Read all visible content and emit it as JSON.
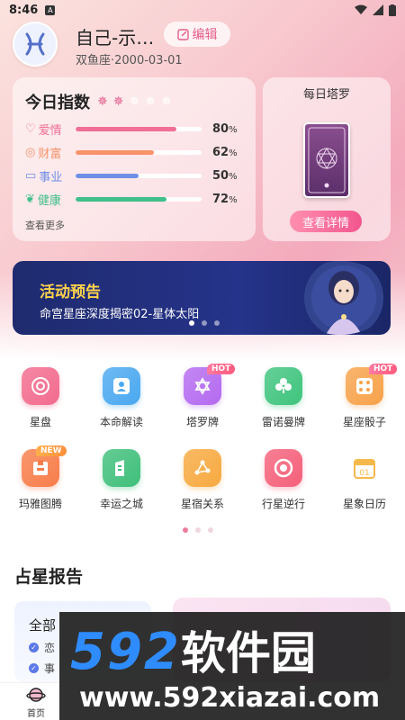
{
  "status": {
    "time": "8:46"
  },
  "profile": {
    "name": "自己-示…",
    "edit_label": "编辑",
    "subtitle": "双鱼座·2000-03-01"
  },
  "today_index": {
    "title": "今日指数",
    "stars_filled": 2,
    "stars_total": 5,
    "more_label": "查看更多",
    "items": [
      {
        "label": "爱情",
        "value": "80",
        "unit": "%",
        "percent": 80,
        "color": "#ef6f97",
        "icon": "heart-icon"
      },
      {
        "label": "财富",
        "value": "62",
        "unit": "%",
        "percent": 62,
        "color": "#f7926a",
        "icon": "coin-icon"
      },
      {
        "label": "事业",
        "value": "50",
        "unit": "%",
        "percent": 50,
        "color": "#6f8fe6",
        "icon": "briefcase-icon"
      },
      {
        "label": "健康",
        "value": "72",
        "unit": "%",
        "percent": 72,
        "color": "#3fbf8a",
        "icon": "leaf-icon"
      }
    ]
  },
  "daily_tarot": {
    "title": "每日塔罗",
    "button_label": "查看详情"
  },
  "banner": {
    "title": "活动预告",
    "subtitle": "命宫星座深度揭密02-星体太阳",
    "pages": 3,
    "active_page": 0
  },
  "features": [
    {
      "label": "星盘",
      "icon": "chart-wheel-icon",
      "color": "#f26b8e",
      "badge": ""
    },
    {
      "label": "本命解读",
      "icon": "person-card-icon",
      "color": "#4aa8f0",
      "badge": ""
    },
    {
      "label": "塔罗牌",
      "icon": "tarot-star-icon",
      "color": "#b46af0",
      "badge": "HOT"
    },
    {
      "label": "雷诺曼牌",
      "icon": "club-icon",
      "color": "#3fc47d",
      "badge": ""
    },
    {
      "label": "星座骰子",
      "icon": "dice-icon",
      "color": "#f7a24a",
      "badge": "HOT"
    },
    {
      "label": "玛雅图腾",
      "icon": "totem-icon",
      "color": "#f77d4a",
      "badge": "NEW"
    },
    {
      "label": "幸运之城",
      "icon": "building-icon",
      "color": "#3fbf7a",
      "badge": ""
    },
    {
      "label": "星宿关系",
      "icon": "constellation-icon",
      "color": "#f7a93f",
      "badge": ""
    },
    {
      "label": "行星逆行",
      "icon": "planet-ring-icon",
      "color": "#f4607a",
      "badge": ""
    },
    {
      "label": "星象日历",
      "icon": "calendar-icon",
      "color": "#f7b84a",
      "badge": "",
      "calendar_day": "01"
    }
  ],
  "features_pages": 3,
  "report": {
    "section_title": "占星报告",
    "card_title": "全部",
    "items": [
      "恋",
      "事"
    ]
  },
  "bottom_nav": {
    "home_label": "首页"
  },
  "watermark": {
    "brand_digits": "592",
    "brand_cn": "软件园",
    "url": "www.592xiazai.com"
  }
}
